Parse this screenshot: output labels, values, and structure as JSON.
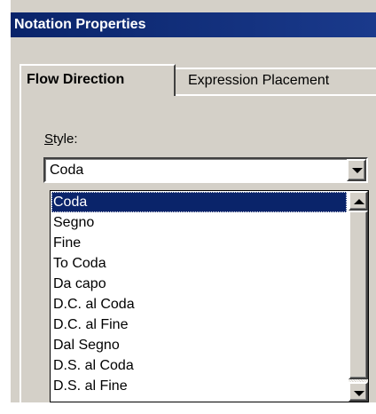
{
  "window": {
    "title": "Notation Properties"
  },
  "tabs": [
    {
      "label": "Flow Direction",
      "active": true
    },
    {
      "label": "Expression Placement",
      "active": false
    }
  ],
  "style_field": {
    "label_mnemonic": "S",
    "label_rest": "tyle:",
    "value": "Coda"
  },
  "dropdown": {
    "selected_index": 0,
    "options": [
      "Coda",
      "Segno",
      "Fine",
      "To Coda",
      "Da capo",
      "D.C. al Coda",
      "D.C. al Fine",
      "Dal Segno",
      "D.S. al Coda",
      "D.S. al Fine"
    ]
  },
  "icons": {
    "combo_arrow": "chevron-down-icon",
    "scroll_up": "arrow-up-icon",
    "scroll_down": "arrow-down-icon"
  },
  "colors": {
    "title_bar": "#0a246a",
    "selection": "#0a246a",
    "face": "#d4d0c8"
  }
}
